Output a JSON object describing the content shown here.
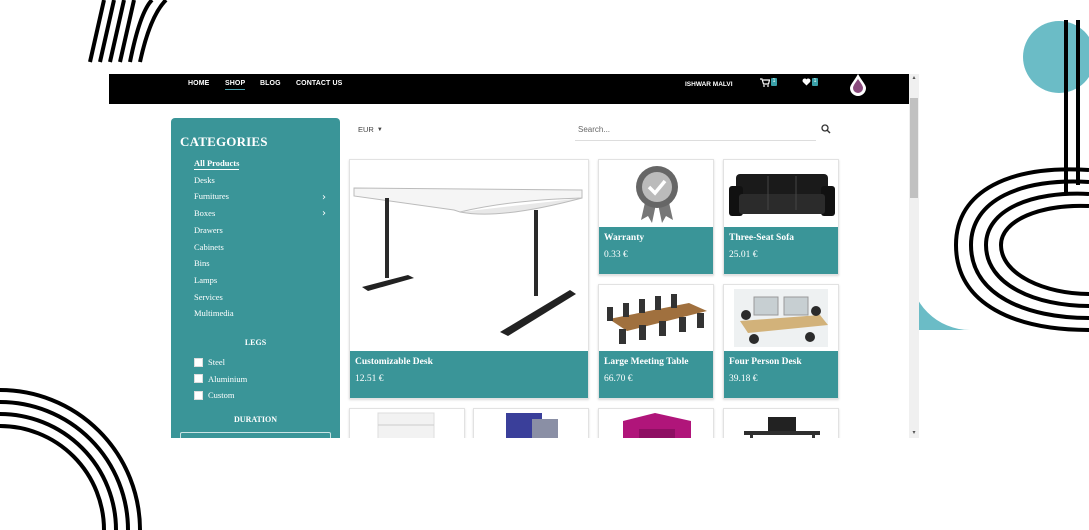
{
  "colors": {
    "accent": "#3a9598",
    "topbar": "#000000",
    "deco_teal": "#6bbcc6"
  },
  "nav": {
    "links": [
      {
        "label": "HOME",
        "active": false
      },
      {
        "label": "SHOP",
        "active": true
      },
      {
        "label": "BLOG",
        "active": false
      },
      {
        "label": "CONTACT US",
        "active": false
      }
    ],
    "user_name": "ISHWAR MALVI",
    "cart_count": "1",
    "wishlist_count": "1"
  },
  "sidebar": {
    "title": "CATEGORIES",
    "categories": [
      {
        "label": "All Products",
        "active": true,
        "has_children": false
      },
      {
        "label": "Desks",
        "active": false,
        "has_children": true
      },
      {
        "label": "Furnitures",
        "active": false,
        "has_children": true
      },
      {
        "label": "Boxes",
        "active": false,
        "has_children": false
      },
      {
        "label": "Drawers",
        "active": false,
        "has_children": false
      },
      {
        "label": "Cabinets",
        "active": false,
        "has_children": false
      },
      {
        "label": "Bins",
        "active": false,
        "has_children": false
      },
      {
        "label": "Lamps",
        "active": false,
        "has_children": false
      },
      {
        "label": "Services",
        "active": false,
        "has_children": false
      },
      {
        "label": "Multimedia",
        "active": false,
        "has_children": false
      }
    ],
    "legs_title": "LEGS",
    "legs_options": [
      {
        "label": "Steel",
        "checked": false
      },
      {
        "label": "Aluminium",
        "checked": false
      },
      {
        "label": "Custom",
        "checked": false
      }
    ],
    "duration_title": "DURATION"
  },
  "toolbar": {
    "currency": "EUR",
    "search_placeholder": "Search..."
  },
  "products": [
    {
      "name": "Customizable Desk",
      "price": "12.51 €",
      "image": "desk"
    },
    {
      "name": "Warranty",
      "price": "0.33 €",
      "image": "warranty-badge"
    },
    {
      "name": "Three-Seat Sofa",
      "price": "25.01 €",
      "image": "sofa"
    },
    {
      "name": "Large Meeting Table",
      "price": "66.70 €",
      "image": "meeting-table"
    },
    {
      "name": "Four Person Desk",
      "price": "39.18 €",
      "image": "four-person-desk"
    },
    {
      "name": "",
      "price": "",
      "image": "drawer-unit"
    },
    {
      "name": "",
      "price": "",
      "image": "screen-panel"
    },
    {
      "name": "",
      "price": "",
      "image": "pink-booth"
    },
    {
      "name": "",
      "price": "",
      "image": "office-desk"
    }
  ]
}
